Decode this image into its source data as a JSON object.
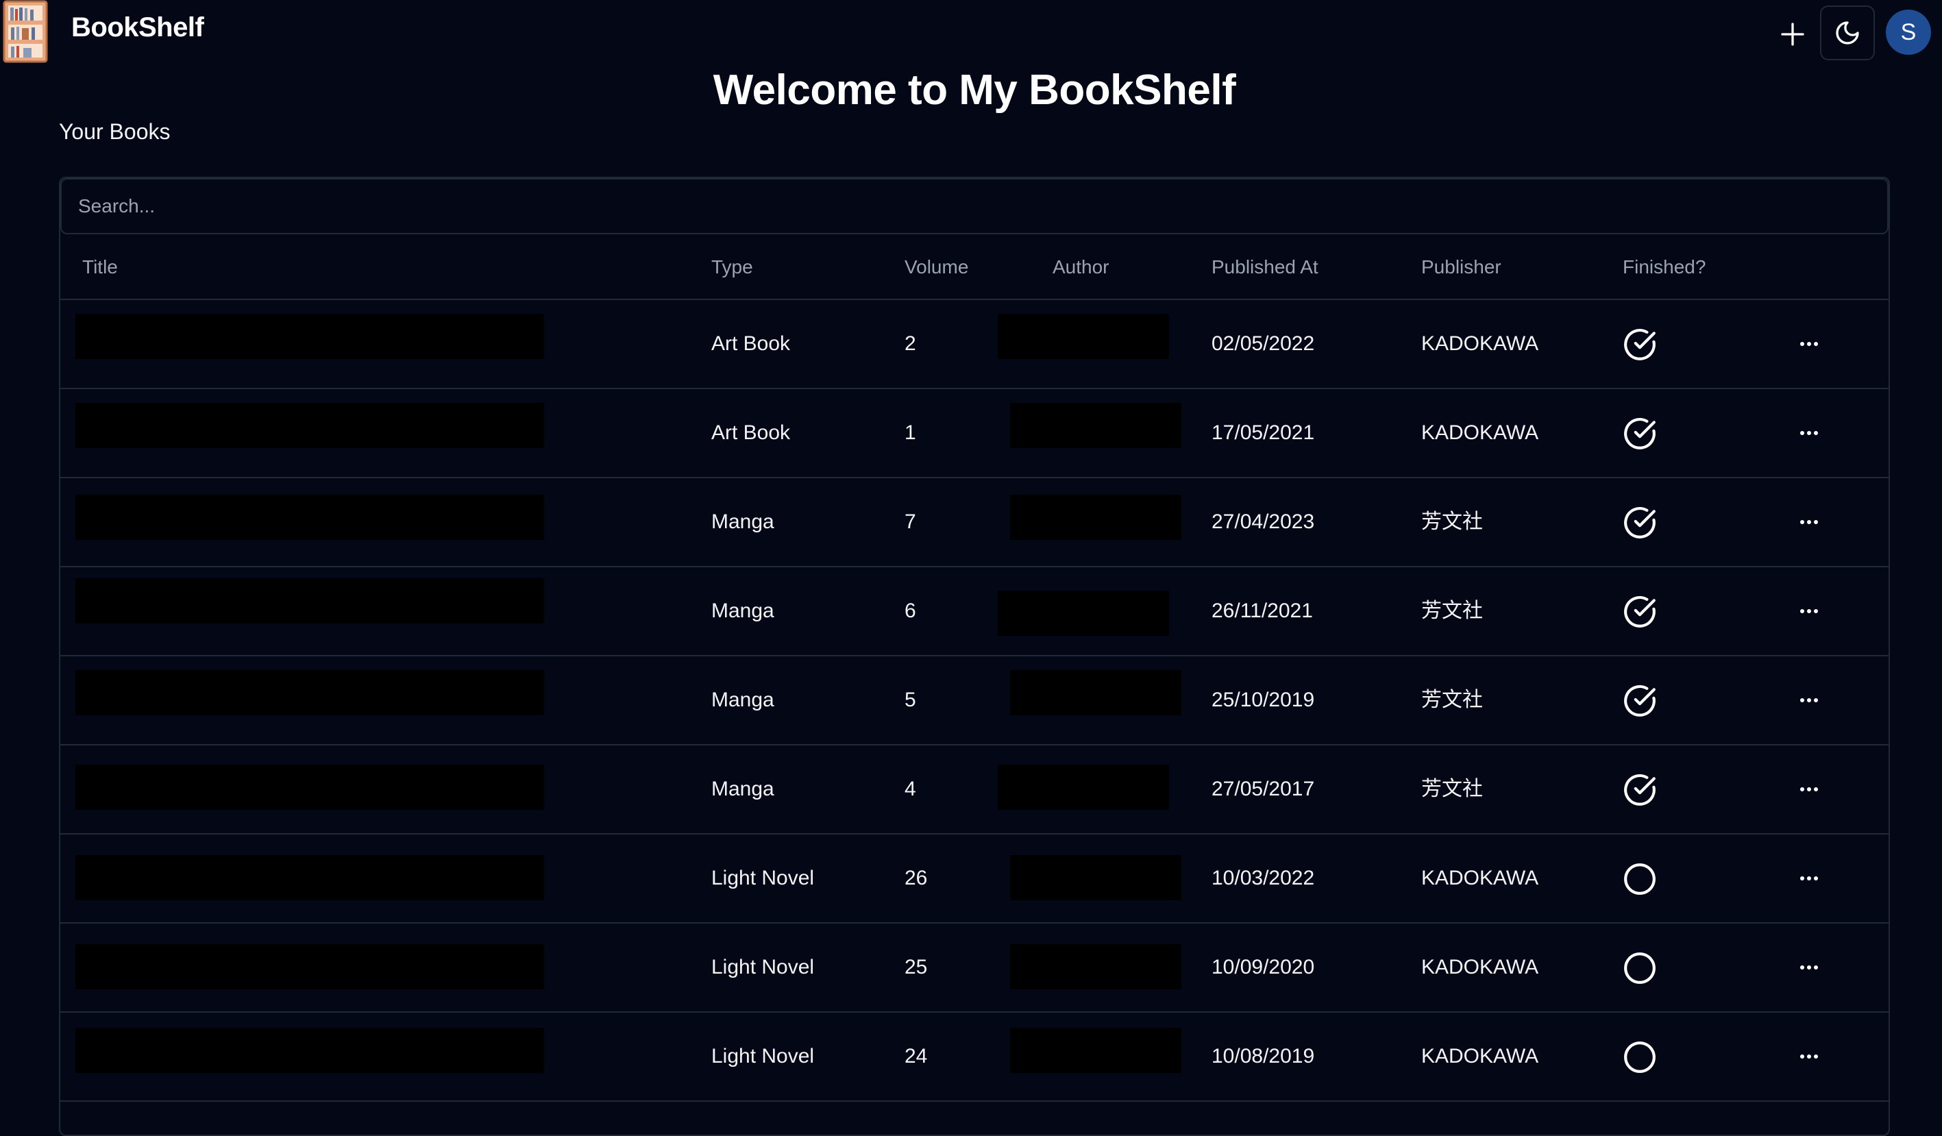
{
  "app": {
    "brand": "BookShelf",
    "title": "Welcome to My BookShelf",
    "section_label": "Your Books",
    "avatar_initial": "S",
    "accent": "#1e4d96"
  },
  "search": {
    "placeholder": "Search..."
  },
  "table": {
    "headers": {
      "title": "Title",
      "type": "Type",
      "volume": "Volume",
      "author": "Author",
      "published_at": "Published At",
      "publisher": "Publisher",
      "finished": "Finished?"
    },
    "rows": [
      {
        "type": "Art Book",
        "volume": "2",
        "published_at": "02/05/2022",
        "publisher": "KADOKAWA",
        "finished": true
      },
      {
        "type": "Art Book",
        "volume": "1",
        "published_at": "17/05/2021",
        "publisher": "KADOKAWA",
        "finished": true
      },
      {
        "type": "Manga",
        "volume": "7",
        "published_at": "27/04/2023",
        "publisher": "芳文社",
        "finished": true
      },
      {
        "type": "Manga",
        "volume": "6",
        "published_at": "26/11/2021",
        "publisher": "芳文社",
        "finished": true
      },
      {
        "type": "Manga",
        "volume": "5",
        "published_at": "25/10/2019",
        "publisher": "芳文社",
        "finished": true
      },
      {
        "type": "Manga",
        "volume": "4",
        "published_at": "27/05/2017",
        "publisher": "芳文社",
        "finished": true
      },
      {
        "type": "Light Novel",
        "volume": "26",
        "published_at": "10/03/2022",
        "publisher": "KADOKAWA",
        "finished": false
      },
      {
        "type": "Light Novel",
        "volume": "25",
        "published_at": "10/09/2020",
        "publisher": "KADOKAWA",
        "finished": false
      },
      {
        "type": "Light Novel",
        "volume": "24",
        "published_at": "10/08/2019",
        "publisher": "KADOKAWA",
        "finished": false
      }
    ]
  }
}
